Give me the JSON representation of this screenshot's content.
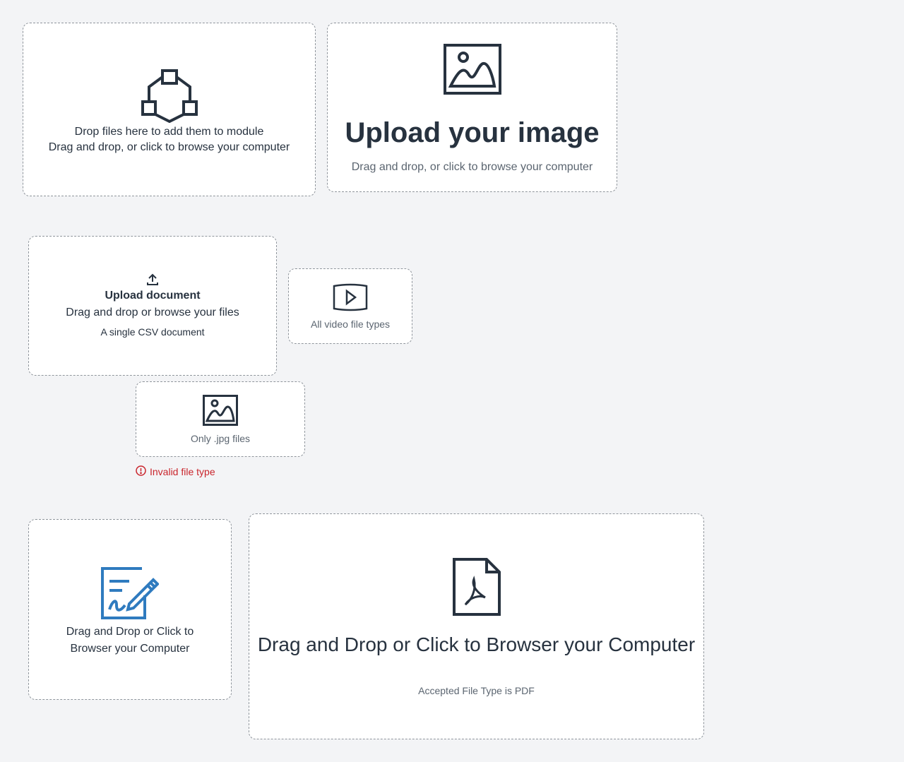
{
  "zones": {
    "module": {
      "line1": "Drop files here to add them to module",
      "line2": "Drag and drop, or click to browse your computer",
      "icon": "module-icon"
    },
    "image": {
      "title": "Upload your image",
      "subtitle": "Drag and drop, or click to browse your computer",
      "icon": "image-icon"
    },
    "document": {
      "title": "Upload document",
      "subtitle": "Drag and drop or browse your files",
      "hint": "A single CSV document",
      "icon": "upload-icon"
    },
    "video": {
      "hint": "All video file types",
      "icon": "video-icon"
    },
    "jpg": {
      "hint": "Only .jpg files",
      "icon": "image-icon",
      "error": "Invalid file type"
    },
    "signature": {
      "label": "Drag and Drop or Click to Browser your Computer",
      "icon": "signature-edit-icon",
      "accent": "#2f7bbf"
    },
    "pdf": {
      "title": "Drag and Drop or Click to Browser your Computer",
      "hint": "Accepted File Type is PDF",
      "icon": "pdf-icon"
    }
  },
  "colors": {
    "background": "#f3f4f6",
    "text": "#27323f",
    "muted": "#5b6570",
    "error": "#c9252c",
    "border": "#8f959c"
  }
}
